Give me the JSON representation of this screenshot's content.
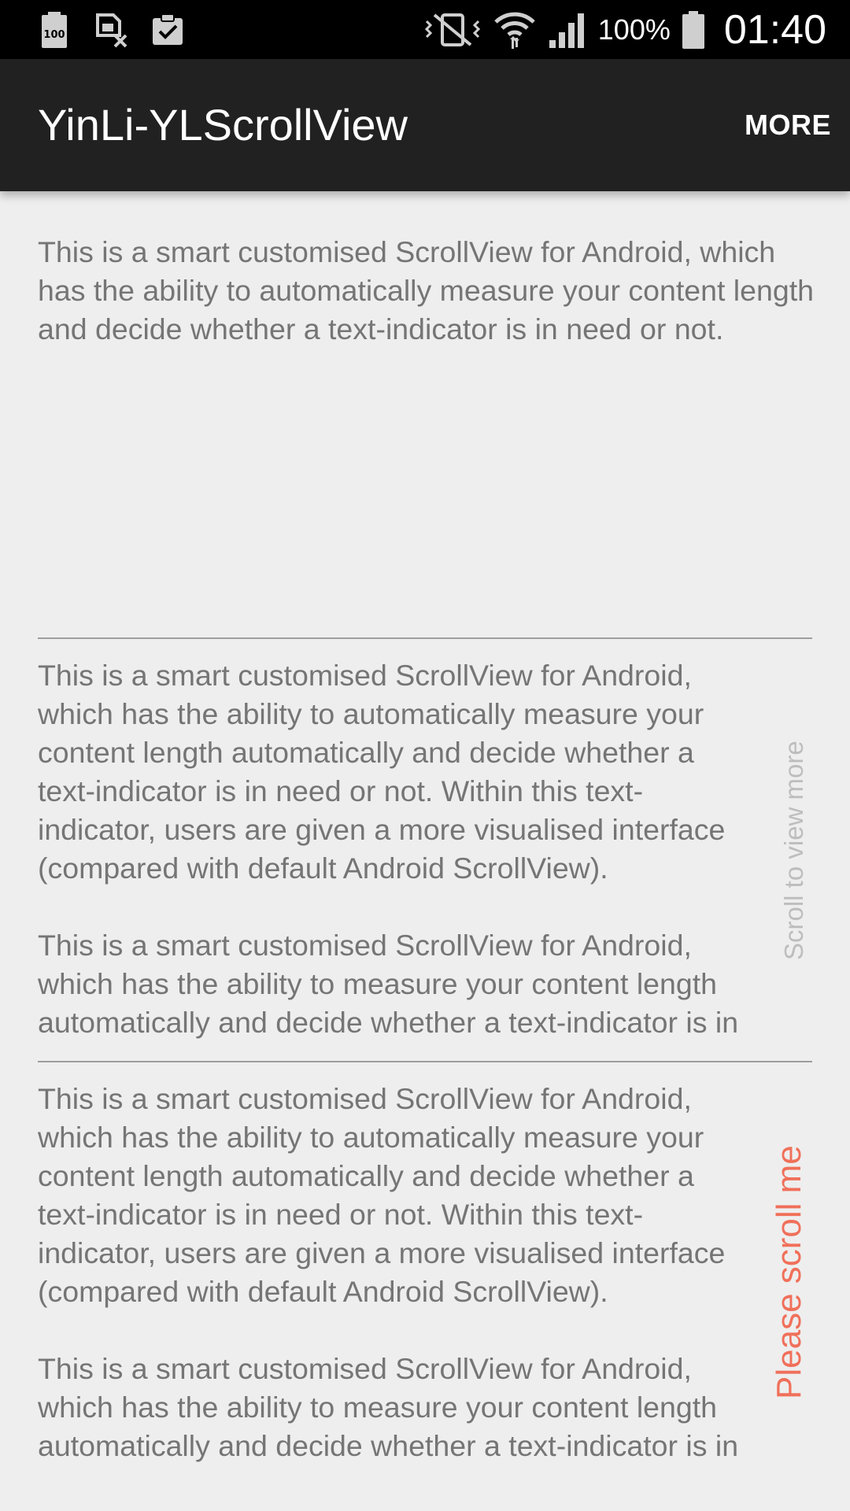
{
  "status_bar": {
    "battery_percent": "100%",
    "time": "01:40",
    "icons": [
      "battery-100-icon",
      "sim-card-x-icon",
      "clipboard-check-icon",
      "mute-vibrate-icon",
      "wifi-icon",
      "signal-icon",
      "battery-icon"
    ]
  },
  "app_bar": {
    "title": "YinLi-YLScrollView",
    "more_label": "MORE"
  },
  "intro": {
    "text": "This is a smart customised ScrollView for Android, which has the ability to automatically measure your content length and decide whether a text-indicator is in need or not."
  },
  "scroll_views": [
    {
      "paragraphs": [
        "This is a smart customised ScrollView for Android, which has the ability to automatically measure your content length automatically and decide whether a text-indicator is in need or not. Within this text-indicator, users are given a more visualised interface (compared with default Android ScrollView).",
        "This is a smart customised ScrollView for Android, which has the ability to measure your content length automatically and decide whether a text-indicator is in need or not."
      ],
      "indicator": "Scroll to view more",
      "indicator_color": "#bdbdbd"
    },
    {
      "paragraphs": [
        "This is a smart customised ScrollView for Android, which has the ability to automatically measure your content length automatically and decide whether a text-indicator is in need or not. Within this text-indicator, users are given a more visualised interface (compared with default Android ScrollView).",
        "This is a smart customised ScrollView for Android, which has the ability to measure your content length automatically and decide whether a text-indicator is in need or not."
      ],
      "indicator": "Please scroll me",
      "indicator_color": "#f0705a"
    }
  ],
  "colors": {
    "status_bar": "#000000",
    "app_bar": "#212121",
    "background": "#eeeeee",
    "body_text": "#757575",
    "divider": "#9e9e9e"
  }
}
